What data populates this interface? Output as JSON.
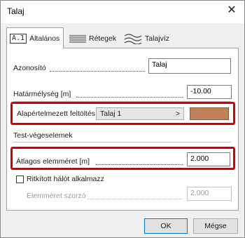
{
  "window": {
    "title": "Talaj"
  },
  "tabs": [
    {
      "icon": "A.1",
      "label": "Általános"
    },
    {
      "label": "Rétegek"
    },
    {
      "label": "Talajvíz"
    }
  ],
  "fields": {
    "id_label": "Azonosító",
    "id_value": "Talaj",
    "depth_label": "Határmélység [m]",
    "depth_value": "-10.00",
    "fill_label": "Alapértelmezett feltöltés",
    "fill_value": "Talaj 1",
    "fill_arrow": ">",
    "fill_color": "#c0805a",
    "section_title": "Test-végeselemek",
    "avg_label": "Átlagos elemméret [m]",
    "avg_value": "2.000",
    "sparse_label": "Ritkított hálót alkalmazz",
    "factor_label": "Elemméret szorzó",
    "factor_value": "2.000"
  },
  "buttons": {
    "ok": "OK",
    "cancel": "Mégse"
  }
}
